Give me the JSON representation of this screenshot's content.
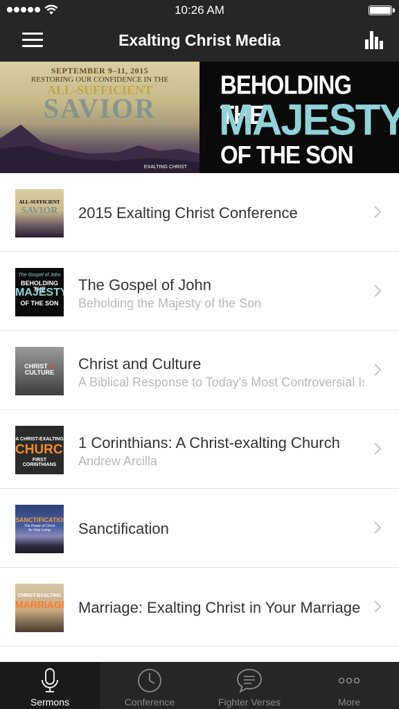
{
  "status_bar": {
    "time": "10:26 AM"
  },
  "nav": {
    "title": "Exalting Christ Media"
  },
  "banner": {
    "left": {
      "date": "SEPTEMBER 9–11, 2015",
      "subtitle": "RESTORING OUR CONFIDENCE IN THE",
      "line_all_sufficient": "ALL-SUFFICIENT",
      "line_savior": "SAVIOR",
      "brand": "EXALTING CHRIST"
    },
    "right": {
      "line1": "BEHOLDING THE",
      "line2": "MAJESTY",
      "line3": "OF THE SON"
    }
  },
  "series": [
    {
      "title": "2015 Exalting Christ Conference",
      "subtitle": "",
      "thumb": {
        "lines": [
          "ALL-SUFFICIENT",
          "SAVIOR"
        ],
        "colors": [
          "#c1a64b",
          "#7f8f8e"
        ]
      }
    },
    {
      "title": "The Gospel of John",
      "subtitle": "Beholding the Majesty of the Son",
      "thumb": {
        "lines": [
          "The Gospel of John",
          "BEHOLDING THE",
          "MAJESTY",
          "OF THE SON"
        ],
        "colors": [
          "#8fd3d8",
          "#ffffff",
          "#8fd3d8",
          "#ffffff"
        ]
      }
    },
    {
      "title": "Christ and Culture",
      "subtitle": "A Biblical Response to Today's Most Controversial Issues",
      "thumb": {
        "lines": [
          "CHRIST",
          "CULTURE"
        ],
        "colors": [
          "#ffffff",
          "#ffffff"
        ]
      }
    },
    {
      "title": "1 Corinthians: A Christ-exalting Church",
      "subtitle": "Andrew Arcilla",
      "thumb": {
        "lines": [
          "A CHRIST-EXALTING",
          "CHURCH",
          "FIRST CORINTHIANS"
        ],
        "colors": [
          "#ffffff",
          "#f08a2c",
          "#ffffff"
        ]
      }
    },
    {
      "title": "Sanctification",
      "subtitle": "",
      "thumb": {
        "lines": [
          "SANCTIFICATION",
          "The Power of Christ",
          "for Holy Living"
        ],
        "colors": [
          "#f0a040",
          "#ffffff",
          "#ffffff"
        ]
      }
    },
    {
      "title": "Marriage: Exalting Christ in Your Marriage",
      "subtitle": "",
      "thumb": {
        "lines": [
          "CHRIST-EXALTING",
          "MARRIAGE"
        ],
        "colors": [
          "#ffffff",
          "#ff7a2a"
        ]
      }
    }
  ],
  "tabs": [
    {
      "label": "Sermons",
      "icon": "microphone-icon",
      "active": true
    },
    {
      "label": "Conference",
      "icon": "clock-icon",
      "active": false
    },
    {
      "label": "Fighter Verses",
      "icon": "speech-bubble-icon",
      "active": false
    },
    {
      "label": "More",
      "icon": "more-dots-icon",
      "active": false
    }
  ],
  "colors": {
    "bar_background": "#262626",
    "accent_teal": "#8fd3d8",
    "text_primary": "#333333",
    "text_secondary": "#b8b8b8"
  }
}
